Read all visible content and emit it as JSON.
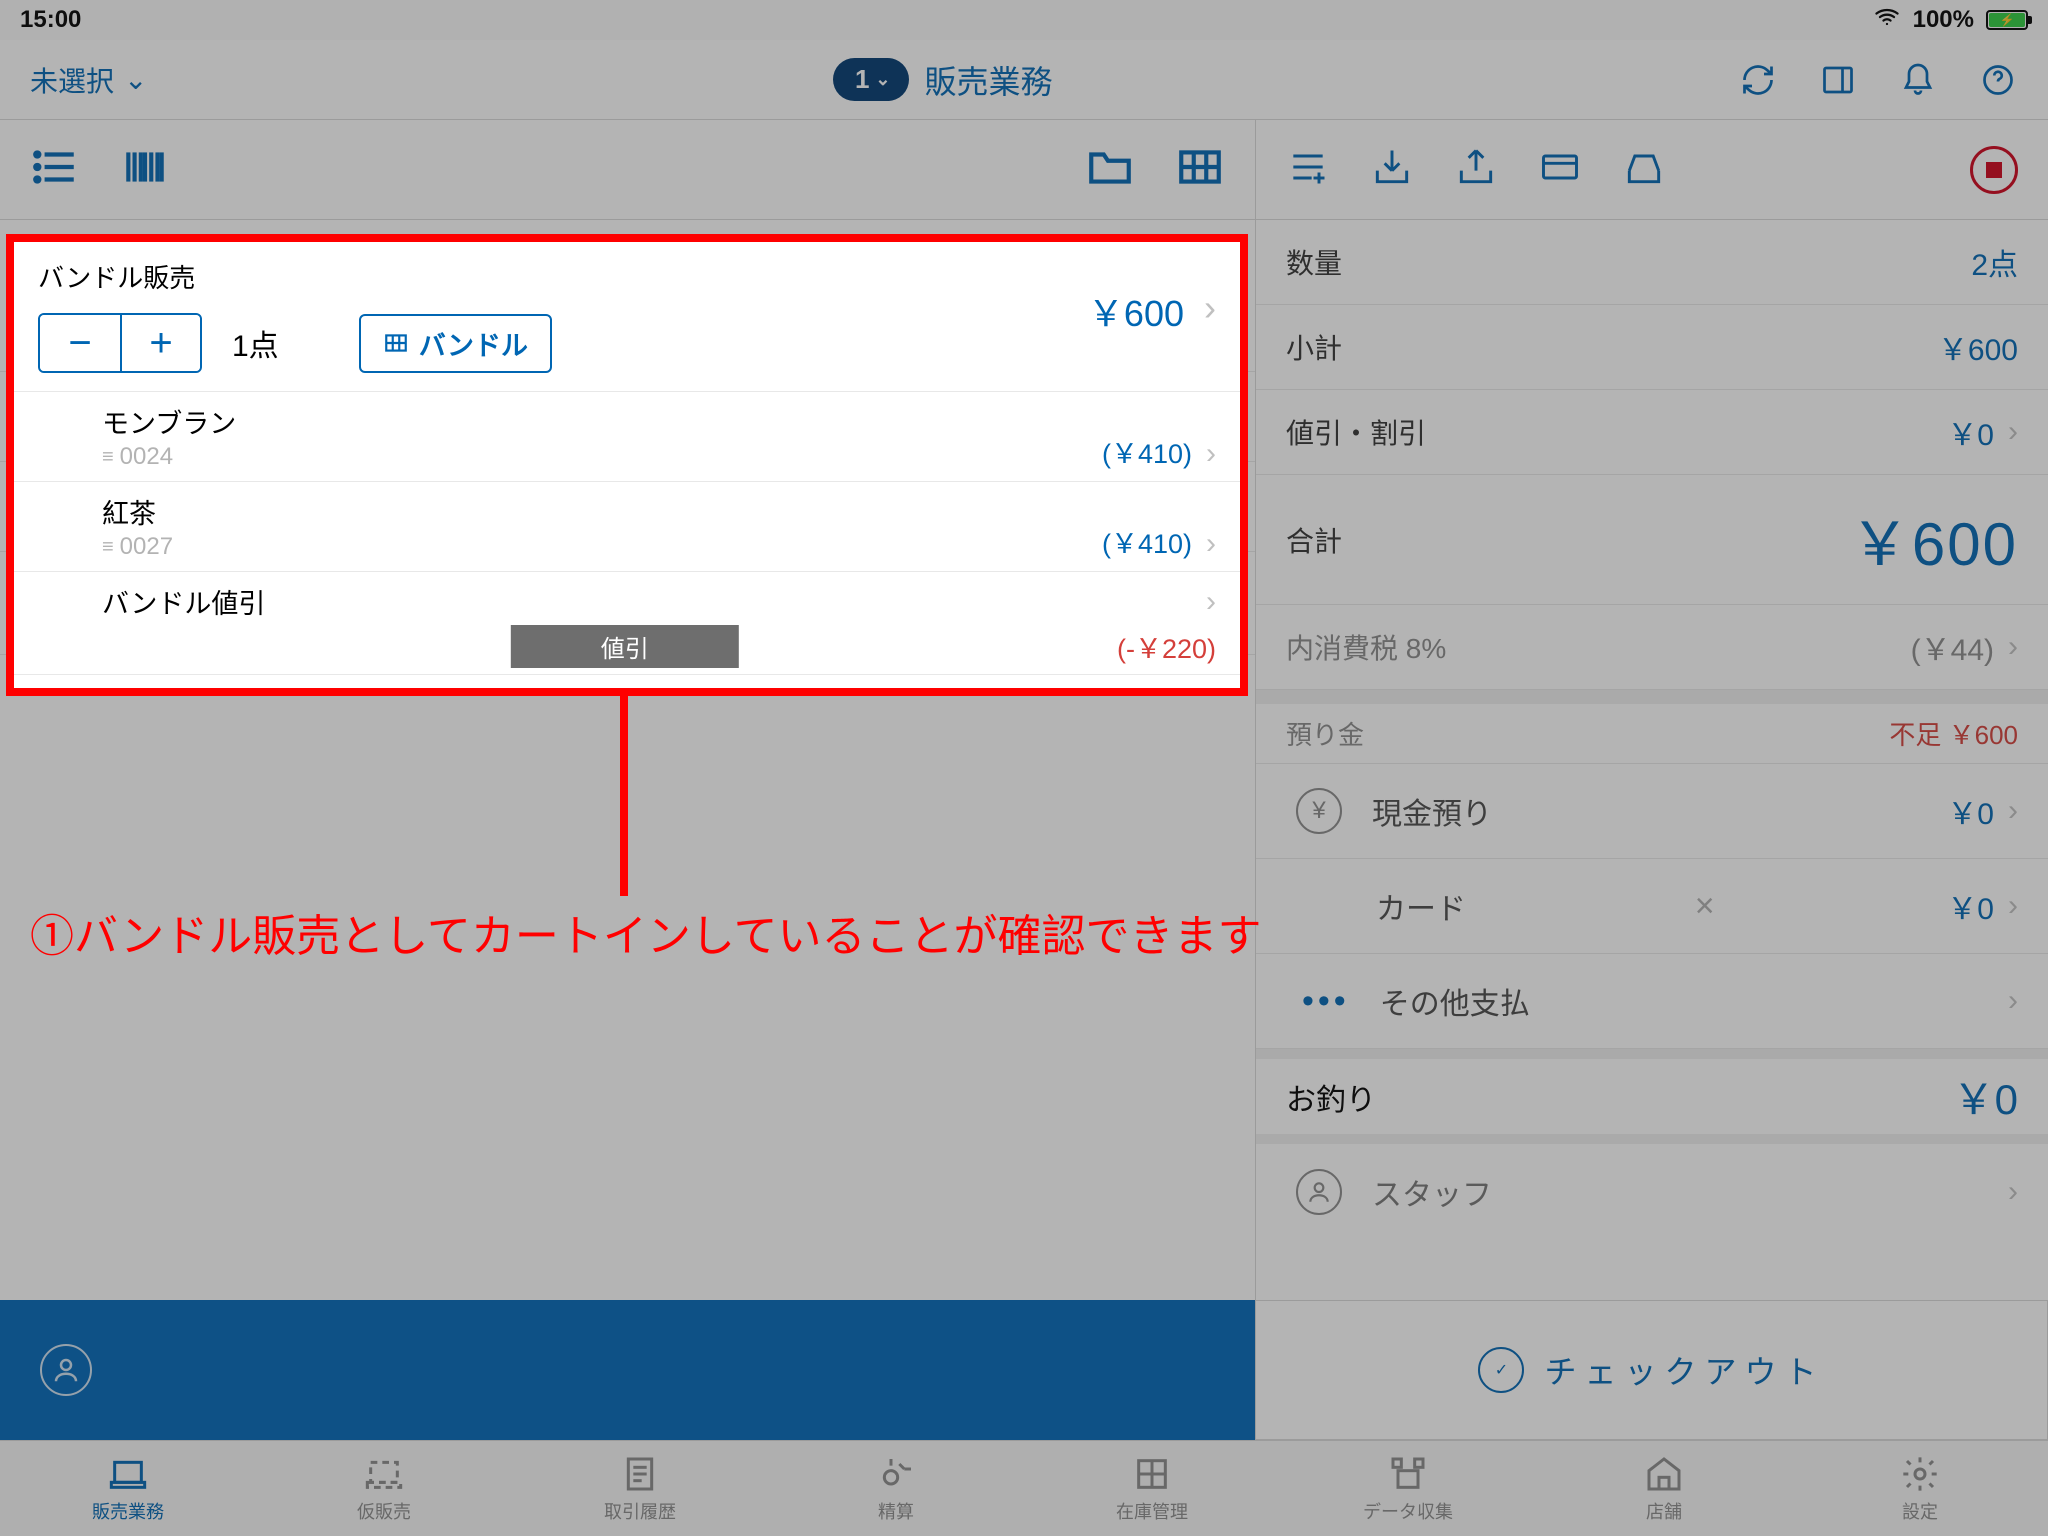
{
  "status": {
    "time": "15:00",
    "battery": "100%"
  },
  "topnav": {
    "selector": "未選択",
    "pill": "1",
    "title": "販売業務"
  },
  "cart": {
    "bundle_title": "バンドル販売",
    "qty": "1点",
    "bundle_badge": "バンドル",
    "bundle_price": "￥600",
    "items": [
      {
        "name": "モンブラン",
        "code": "0024",
        "price": "(￥410)"
      },
      {
        "name": "紅茶",
        "code": "0027",
        "price": "(￥410)"
      }
    ],
    "discount_label": "バンドル値引",
    "discount_tag": "値引",
    "discount_amount": "(-￥220)"
  },
  "summary": {
    "qty_label": "数量",
    "qty_value": "2点",
    "subtotal_label": "小計",
    "subtotal_value": "￥600",
    "discount_label": "値引・割引",
    "discount_value": "￥0",
    "total_label": "合計",
    "total_value": "￥600",
    "tax_label": "内消費税 8%",
    "tax_value": "(￥44)",
    "deposit_header": "預り金",
    "shortage": "不足 ￥600",
    "cash_label": "現金預り",
    "cash_value": "￥0",
    "card_label": "カード",
    "card_value": "￥0",
    "other_label": "その他支払",
    "change_label": "お釣り",
    "change_value": "￥0",
    "staff_label": "スタッフ"
  },
  "checkout": {
    "label": "チェックアウト"
  },
  "tabs": {
    "t1": "販売業務",
    "t2": "仮販売",
    "t3": "取引履歴",
    "t4": "精算",
    "t5": "在庫管理",
    "t6": "データ収集",
    "t7": "店舗",
    "t8": "設定"
  },
  "annotation": {
    "text": "①バンドル販売としてカートインしていることが確認できます"
  }
}
